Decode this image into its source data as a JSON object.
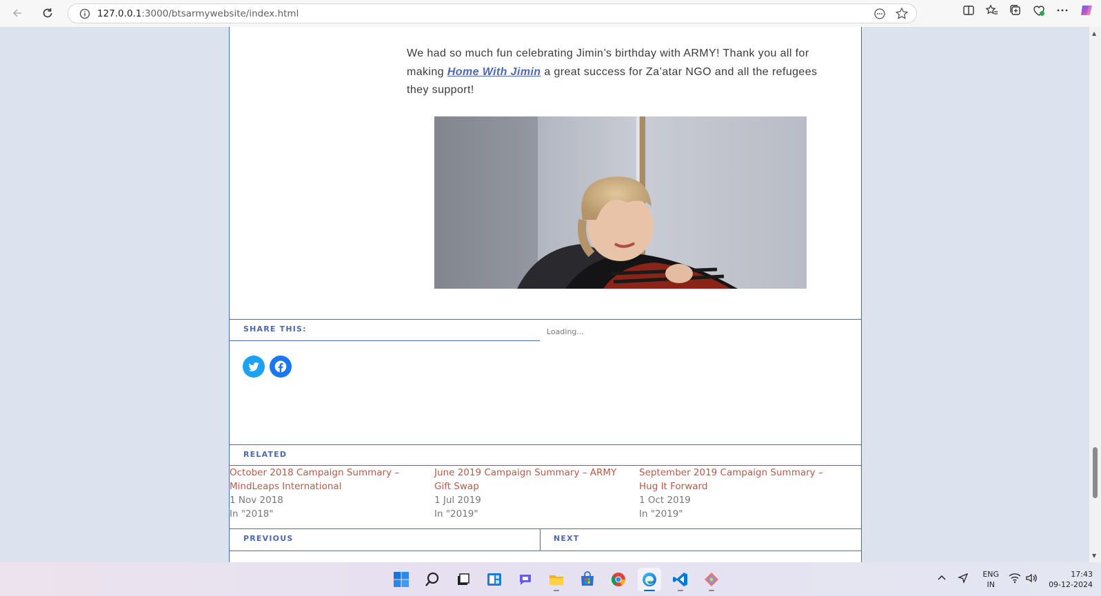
{
  "browser": {
    "url_host": "127.0.0.1",
    "url_rest": ":3000/btsarmywebsite/index.html"
  },
  "post": {
    "text_before": "We had so much fun celebrating Jimin’s birthday with ARMY! Thank you all for making ",
    "link_text": "Home With Jimin",
    "text_after": " a great success for Za’atar NGO and all the refugees they support!"
  },
  "share": {
    "label": "SHARE THIS:",
    "loading": "Loading...",
    "buttons": [
      "twitter-icon",
      "facebook-icon"
    ]
  },
  "related": {
    "label": "RELATED",
    "items": [
      {
        "title": "October 2018 Campaign Summary – MindLeaps International",
        "date": "1 Nov 2018",
        "category": "In \"2018\""
      },
      {
        "title": "June 2019 Campaign Summary – ARMY Gift Swap",
        "date": "1 Jul 2019",
        "category": "In \"2019\""
      },
      {
        "title": "September 2019 Campaign Summary – Hug It Forward",
        "date": "1 Oct 2019",
        "category": "In \"2019\""
      }
    ]
  },
  "nav": {
    "previous": "PREVIOUS",
    "next": "NEXT"
  },
  "taskbar": {
    "lang_top": "ENG",
    "lang_bottom": "IN",
    "time": "17:43",
    "date": "09-12-2024"
  },
  "colors": {
    "accent": "#4c67b3",
    "related_title": "#b55a4a",
    "twitter": "#1da1f2",
    "facebook": "#1877f2"
  }
}
